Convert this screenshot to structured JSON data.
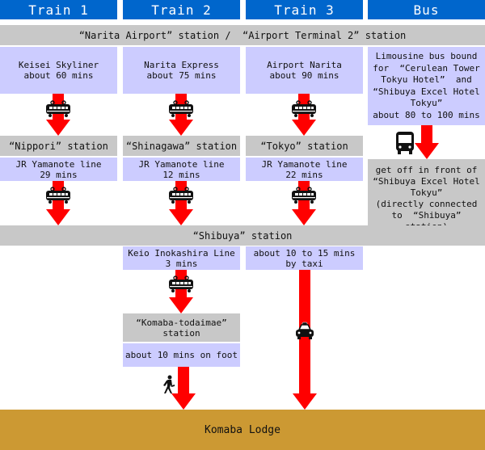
{
  "headers": [
    "Train 1",
    "Train 2",
    "Train 3",
    "Bus"
  ],
  "airport_station": "“Narita Airport” station /  “Airport Terminal 2” station",
  "first_leg": [
    [
      "Keisei Skyliner",
      "about 60 mins"
    ],
    [
      "Narita Express",
      "about 75 mins"
    ],
    [
      "Airport Narita",
      "about 90 mins"
    ],
    [
      "Limousine bus bound",
      "for  “Cerulean Tower",
      "Tokyu Hotel”  and",
      "“Shibuya Excel Hotel",
      "Tokyu”",
      "about 80 to 100 mins"
    ]
  ],
  "transfer_stations": [
    "“Nippori” station",
    "“Shinagawa” station",
    "“Tokyo” station"
  ],
  "second_leg": [
    [
      "JR Yamanote line",
      "29 mins"
    ],
    [
      "JR Yamanote line",
      "12 mins"
    ],
    [
      "JR Yamanote line",
      "22 mins"
    ]
  ],
  "bus_dropoff": [
    "get off in front of",
    "“Shibuya Excel Hotel",
    "Tokyu”",
    "(directly connected",
    "to  “Shibuya”",
    "station)"
  ],
  "shibuya_station": "“Shibuya” station",
  "keio_leg": [
    "Keio Inokashira Line",
    "3 mins"
  ],
  "taxi_leg": [
    "about 10 to 15 mins",
    "by taxi"
  ],
  "komaba_station": [
    "“Komaba-todaimae”",
    "station"
  ],
  "foot_leg": "about 10 mins on foot",
  "destination": "Komaba Lodge",
  "icons": {
    "train": "train-icon",
    "bus": "bus-icon",
    "taxi": "taxi-icon",
    "walk": "walking-person-icon"
  },
  "colors": {
    "header": "#0066cc",
    "station": "#c8c8c8",
    "route": "#ccccff",
    "arrow": "#ff0000",
    "destination": "#cc9933"
  }
}
